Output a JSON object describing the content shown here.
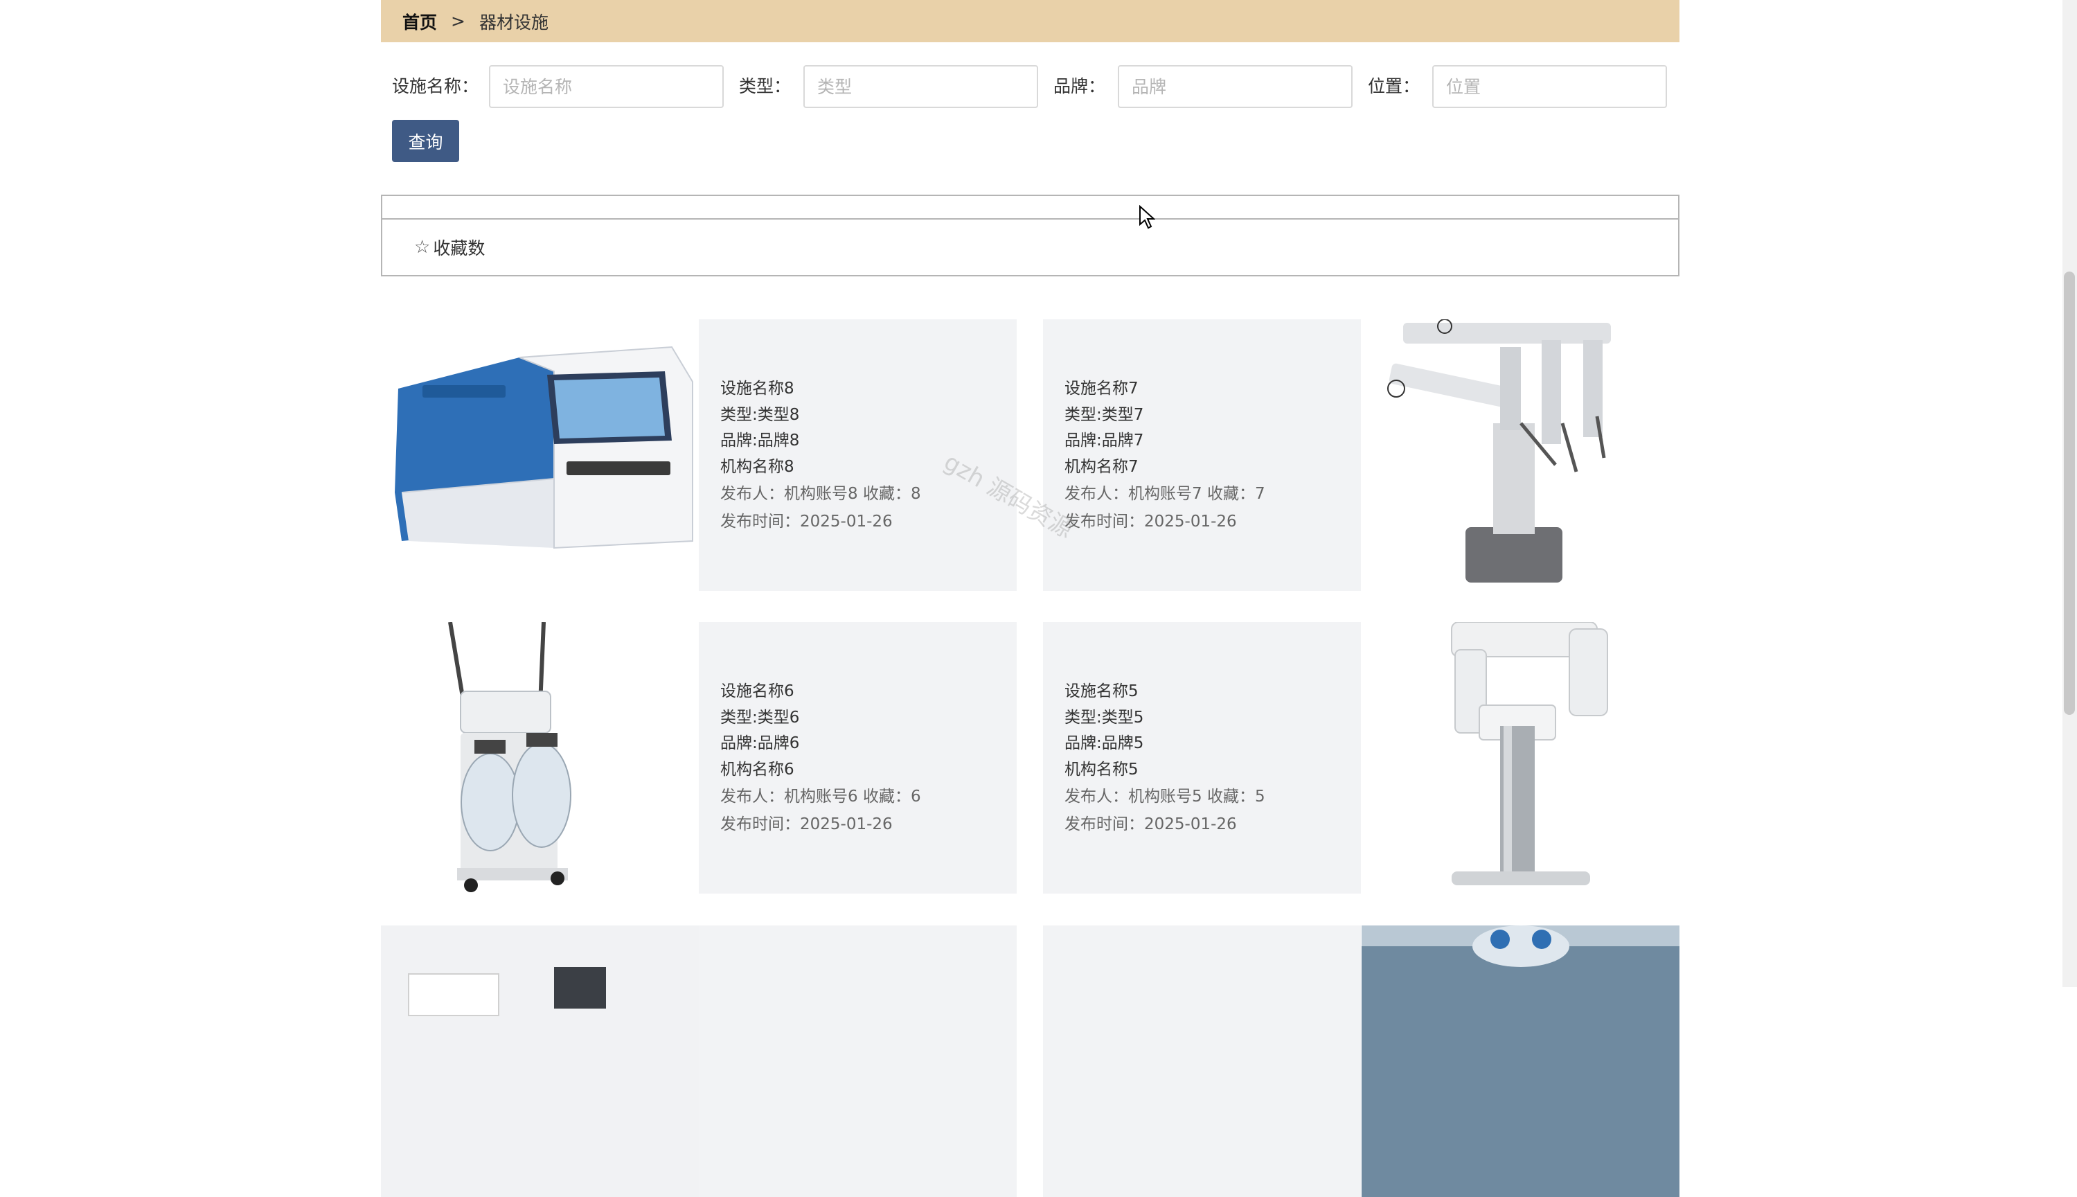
{
  "breadcrumb": {
    "home": "首页",
    "separator": ">",
    "current": "器材设施"
  },
  "search": {
    "fields": [
      {
        "label": "设施名称：",
        "placeholder": "设施名称"
      },
      {
        "label": "类型：",
        "placeholder": "类型"
      },
      {
        "label": "品牌：",
        "placeholder": "品牌"
      },
      {
        "label": "位置：",
        "placeholder": "位置"
      }
    ],
    "button_label": "查询",
    "button_color": "#3f5a85"
  },
  "sort": {
    "icon": "star-outline-icon",
    "label": "收藏数"
  },
  "items": [
    {
      "name": "设施名称8",
      "type": "类型:类型8",
      "brand": "品牌:品牌8",
      "org": "机构名称8",
      "publisher_line": "发布人：机构账号8   收藏：8",
      "time_line": "发布时间：2025-01-26",
      "image": "microplate-reader-image"
    },
    {
      "name": "设施名称7",
      "type": "类型:类型7",
      "brand": "品牌:品牌7",
      "org": "机构名称7",
      "publisher_line": "发布人：机构账号7   收藏：7",
      "time_line": "发布时间：2025-01-26",
      "image": "surgical-robot-image"
    },
    {
      "name": "设施名称6",
      "type": "类型:类型6",
      "brand": "品牌:品牌6",
      "org": "机构名称6",
      "publisher_line": "发布人：机构账号6   收藏：6",
      "time_line": "发布时间：2025-01-26",
      "image": "suction-unit-image"
    },
    {
      "name": "设施名称5",
      "type": "类型:类型5",
      "brand": "品牌:品牌5",
      "org": "机构名称5",
      "publisher_line": "发布人：机构账号5   收藏：5",
      "time_line": "发布时间：2025-01-26",
      "image": "dental-xray-unit-image"
    }
  ],
  "watermark": "gzh 源码资源",
  "theme": {
    "header_bg": "#e9d1a9",
    "card_bg": "#f2f3f5"
  }
}
